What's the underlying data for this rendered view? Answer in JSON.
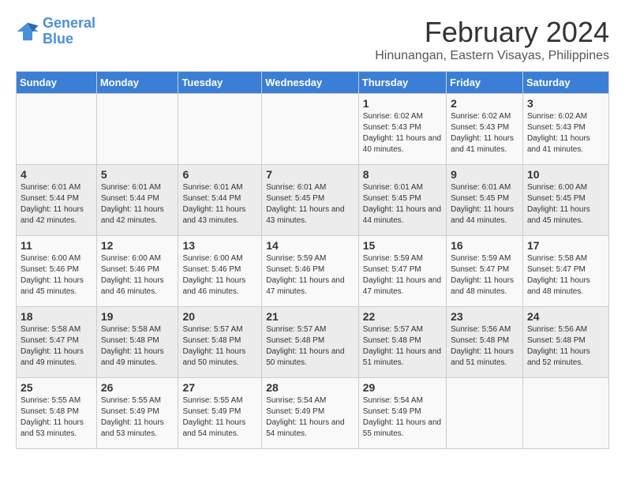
{
  "logo": {
    "line1": "General",
    "line2": "Blue"
  },
  "title": "February 2024",
  "location": "Hinunangan, Eastern Visayas, Philippines",
  "days_of_week": [
    "Sunday",
    "Monday",
    "Tuesday",
    "Wednesday",
    "Thursday",
    "Friday",
    "Saturday"
  ],
  "weeks": [
    [
      {
        "day": "",
        "detail": ""
      },
      {
        "day": "",
        "detail": ""
      },
      {
        "day": "",
        "detail": ""
      },
      {
        "day": "",
        "detail": ""
      },
      {
        "day": "1",
        "detail": "Sunrise: 6:02 AM\nSunset: 5:43 PM\nDaylight: 11 hours\nand 40 minutes."
      },
      {
        "day": "2",
        "detail": "Sunrise: 6:02 AM\nSunset: 5:43 PM\nDaylight: 11 hours\nand 41 minutes."
      },
      {
        "day": "3",
        "detail": "Sunrise: 6:02 AM\nSunset: 5:43 PM\nDaylight: 11 hours\nand 41 minutes."
      }
    ],
    [
      {
        "day": "4",
        "detail": "Sunrise: 6:01 AM\nSunset: 5:44 PM\nDaylight: 11 hours\nand 42 minutes."
      },
      {
        "day": "5",
        "detail": "Sunrise: 6:01 AM\nSunset: 5:44 PM\nDaylight: 11 hours\nand 42 minutes."
      },
      {
        "day": "6",
        "detail": "Sunrise: 6:01 AM\nSunset: 5:44 PM\nDaylight: 11 hours\nand 43 minutes."
      },
      {
        "day": "7",
        "detail": "Sunrise: 6:01 AM\nSunset: 5:45 PM\nDaylight: 11 hours\nand 43 minutes."
      },
      {
        "day": "8",
        "detail": "Sunrise: 6:01 AM\nSunset: 5:45 PM\nDaylight: 11 hours\nand 44 minutes."
      },
      {
        "day": "9",
        "detail": "Sunrise: 6:01 AM\nSunset: 5:45 PM\nDaylight: 11 hours\nand 44 minutes."
      },
      {
        "day": "10",
        "detail": "Sunrise: 6:00 AM\nSunset: 5:45 PM\nDaylight: 11 hours\nand 45 minutes."
      }
    ],
    [
      {
        "day": "11",
        "detail": "Sunrise: 6:00 AM\nSunset: 5:46 PM\nDaylight: 11 hours\nand 45 minutes."
      },
      {
        "day": "12",
        "detail": "Sunrise: 6:00 AM\nSunset: 5:46 PM\nDaylight: 11 hours\nand 46 minutes."
      },
      {
        "day": "13",
        "detail": "Sunrise: 6:00 AM\nSunset: 5:46 PM\nDaylight: 11 hours\nand 46 minutes."
      },
      {
        "day": "14",
        "detail": "Sunrise: 5:59 AM\nSunset: 5:46 PM\nDaylight: 11 hours\nand 47 minutes."
      },
      {
        "day": "15",
        "detail": "Sunrise: 5:59 AM\nSunset: 5:47 PM\nDaylight: 11 hours\nand 47 minutes."
      },
      {
        "day": "16",
        "detail": "Sunrise: 5:59 AM\nSunset: 5:47 PM\nDaylight: 11 hours\nand 48 minutes."
      },
      {
        "day": "17",
        "detail": "Sunrise: 5:58 AM\nSunset: 5:47 PM\nDaylight: 11 hours\nand 48 minutes."
      }
    ],
    [
      {
        "day": "18",
        "detail": "Sunrise: 5:58 AM\nSunset: 5:47 PM\nDaylight: 11 hours\nand 49 minutes."
      },
      {
        "day": "19",
        "detail": "Sunrise: 5:58 AM\nSunset: 5:48 PM\nDaylight: 11 hours\nand 49 minutes."
      },
      {
        "day": "20",
        "detail": "Sunrise: 5:57 AM\nSunset: 5:48 PM\nDaylight: 11 hours\nand 50 minutes."
      },
      {
        "day": "21",
        "detail": "Sunrise: 5:57 AM\nSunset: 5:48 PM\nDaylight: 11 hours\nand 50 minutes."
      },
      {
        "day": "22",
        "detail": "Sunrise: 5:57 AM\nSunset: 5:48 PM\nDaylight: 11 hours\nand 51 minutes."
      },
      {
        "day": "23",
        "detail": "Sunrise: 5:56 AM\nSunset: 5:48 PM\nDaylight: 11 hours\nand 51 minutes."
      },
      {
        "day": "24",
        "detail": "Sunrise: 5:56 AM\nSunset: 5:48 PM\nDaylight: 11 hours\nand 52 minutes."
      }
    ],
    [
      {
        "day": "25",
        "detail": "Sunrise: 5:55 AM\nSunset: 5:48 PM\nDaylight: 11 hours\nand 53 minutes."
      },
      {
        "day": "26",
        "detail": "Sunrise: 5:55 AM\nSunset: 5:49 PM\nDaylight: 11 hours\nand 53 minutes."
      },
      {
        "day": "27",
        "detail": "Sunrise: 5:55 AM\nSunset: 5:49 PM\nDaylight: 11 hours\nand 54 minutes."
      },
      {
        "day": "28",
        "detail": "Sunrise: 5:54 AM\nSunset: 5:49 PM\nDaylight: 11 hours\nand 54 minutes."
      },
      {
        "day": "29",
        "detail": "Sunrise: 5:54 AM\nSunset: 5:49 PM\nDaylight: 11 hours\nand 55 minutes."
      },
      {
        "day": "",
        "detail": ""
      },
      {
        "day": "",
        "detail": ""
      }
    ]
  ]
}
